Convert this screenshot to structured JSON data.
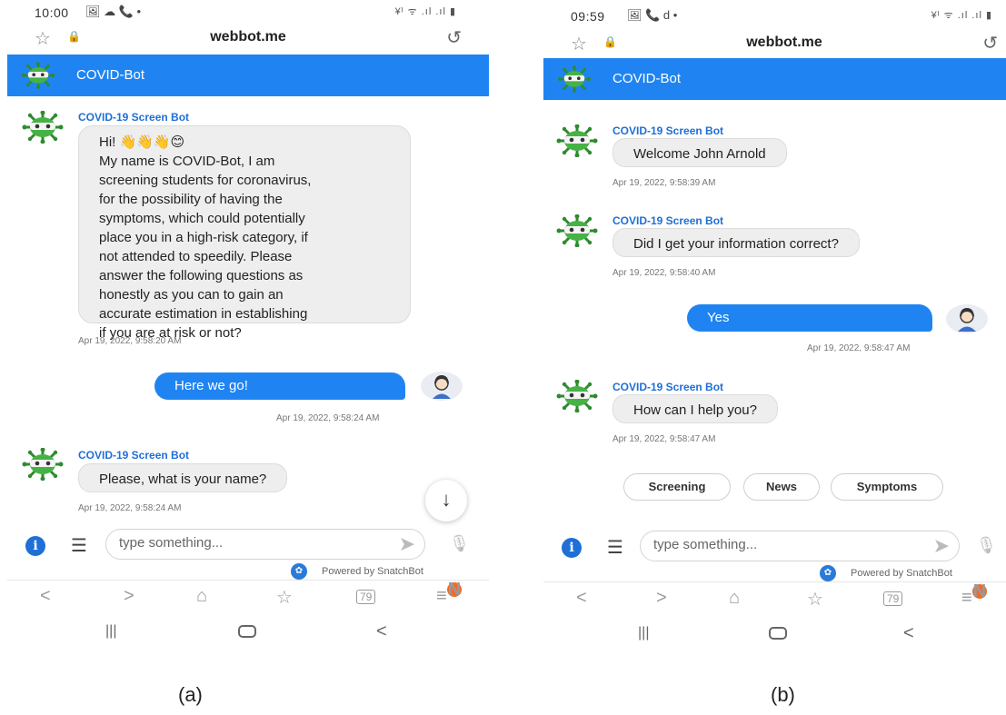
{
  "colors": {
    "brand": "#1f84f1",
    "sender": "#1f6fd6",
    "bubble": "#eeeeee",
    "badge": "#f26b2a"
  },
  "captions": {
    "a": "(a)",
    "b": "(b)"
  },
  "phone_a": {
    "status": {
      "time": "10:00",
      "icons_left": "🖼 ☁ 📞 •",
      "icons_right": "¥ᴵ ᯤ .ıl .ıl ▮"
    },
    "browser": {
      "url": "webbot.me"
    },
    "header": {
      "title": "COVID-Bot"
    },
    "messages": [
      {
        "sender": "COVID-19 Screen Bot",
        "lines": [
          "Hi! 👋👋👋😊",
          "My name is COVID-Bot,  I am",
          "screening students for coronavirus,",
          "for the possibility of having the",
          "symptoms, which could potentially",
          "place you in a high-risk category,  if",
          "not attended to speedily. Please",
          "answer the following questions as",
          "honestly as you can to gain an",
          "accurate estimation in establishing",
          "if you are at risk or not?"
        ],
        "timestamp": "Apr 19, 2022, 9:58:20 AM"
      },
      {
        "user_text": "Here we go!",
        "timestamp": "Apr 19, 2022, 9:58:24 AM"
      },
      {
        "sender": "COVID-19 Screen Bot",
        "text": "Please, what is your name?",
        "timestamp": "Apr 19, 2022, 9:58:24 AM"
      }
    ],
    "input": {
      "placeholder": "type something..."
    },
    "powered_by": "Powered by SnatchBot",
    "tab_count": "79",
    "notification_badge": "N"
  },
  "phone_b": {
    "status": {
      "time": "09:59",
      "icons_left": "🖼 📞 d •",
      "icons_right": "¥ᴵ ᯤ .ıl .ıl ▮"
    },
    "browser": {
      "url": "webbot.me"
    },
    "header": {
      "title": "COVID-Bot"
    },
    "messages": [
      {
        "sender": "COVID-19 Screen Bot",
        "text": "Welcome John Arnold",
        "timestamp": "Apr 19, 2022, 9:58:39 AM"
      },
      {
        "sender": "COVID-19 Screen Bot",
        "text": "Did I get your information correct?",
        "timestamp": "Apr 19, 2022, 9:58:40 AM"
      },
      {
        "user_text": "Yes",
        "timestamp": "Apr 19, 2022, 9:58:47 AM"
      },
      {
        "sender": "COVID-19 Screen Bot",
        "text": "How can I help you?",
        "timestamp": "Apr 19, 2022, 9:58:47 AM"
      }
    ],
    "quick_replies": [
      "Screening",
      "News",
      "Symptoms"
    ],
    "input": {
      "placeholder": "type something..."
    },
    "powered_by": "Powered by SnatchBot",
    "tab_count": "79",
    "notification_badge": "N"
  }
}
